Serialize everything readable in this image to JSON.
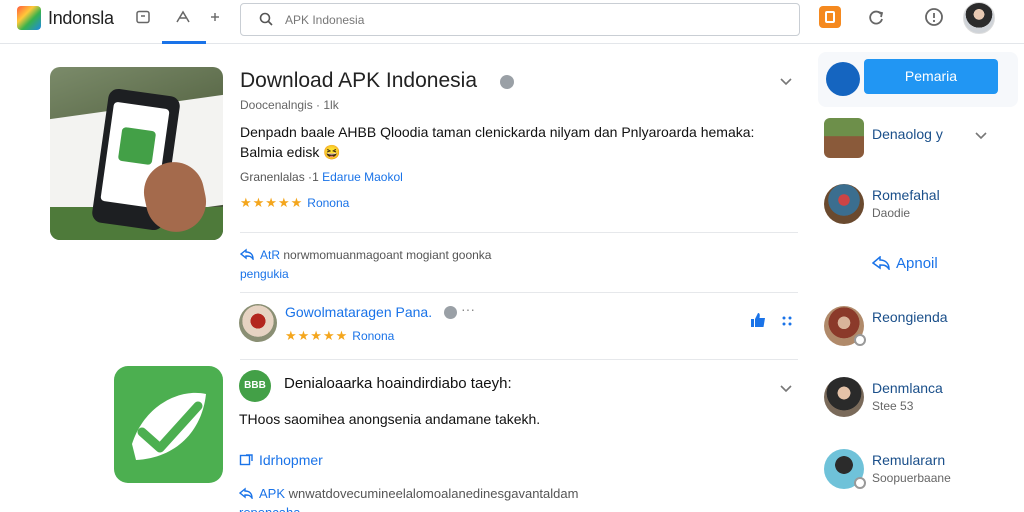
{
  "header": {
    "brand": "Indonsla",
    "search_placeholder": "APK Indonesia"
  },
  "main": {
    "title": "Download APK Indonesia",
    "meta": "Doocenalngis · 1lk",
    "description": "Denpadn baale AHBB Qloodia taman clenickarda nilyam dan Pnlyaroarda hemaka: Balmia edisk",
    "description_emoji": "😆",
    "category_prefix": "Granenlalas",
    "category_link": "Edarue Maokol",
    "rating_label": "Ronona",
    "apk_line_prefix": "AtR",
    "apk_line_text": "norwmomuanmagoant mogiant goonka",
    "apk_line_link": "pengukia"
  },
  "review": {
    "name": "Gowolmataragen Pana.",
    "dots": "···",
    "rating_label": "Ronona"
  },
  "item2": {
    "badge": "BBB",
    "title": "Denialoaarka hoaindirdiabo taeyh:",
    "description": "THoos saomihea anongsenia andamane takekh.",
    "link": "Idrhopmer",
    "apk_prefix": "APK",
    "apk_text": "wnwatdovecumineelalomoalanedinesgavantaldam",
    "apk_more": "repencaha"
  },
  "sidebar": {
    "button": "Pemaria",
    "items": [
      {
        "name": "Denaolog y",
        "sub": ""
      },
      {
        "name": "Romefahal",
        "sub": "Daodie"
      },
      {
        "name": "Reongienda",
        "sub": ""
      },
      {
        "name": "Denmlanca",
        "sub": "Stee 53"
      },
      {
        "name": "Remulararn",
        "sub": "Soopuerbaane"
      }
    ],
    "link": "Apnoil"
  },
  "colors": {
    "accent": "#1a73e8",
    "button": "#2196f3",
    "star": "#f4a61d",
    "app_green": "#4caf50"
  },
  "rating": {
    "stars": 5
  }
}
